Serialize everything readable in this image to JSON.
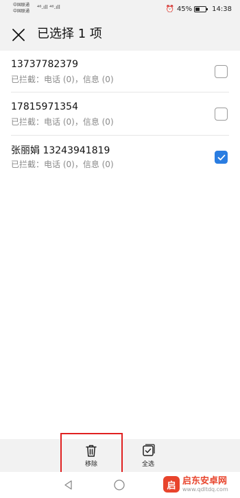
{
  "status_bar": {
    "carrier_1": "中国联通",
    "carrier_2": "中国联通",
    "signal": "⁴⁶.ıll ⁴⁶.ıll",
    "battery_percent": "45%",
    "battery_level": 0.45,
    "time": "14:38"
  },
  "header": {
    "close_icon": "close-icon",
    "title": "已选择 1 项"
  },
  "contacts": [
    {
      "number": "13737782379",
      "blocked": "已拦截：电话 (0)，信息 (0)",
      "checked": false
    },
    {
      "number": "17815971354",
      "blocked": "已拦截：电话 (0)，信息 (0)",
      "checked": false
    },
    {
      "number": "张丽娟 13243941819",
      "blocked": "已拦截：电话 (0)，信息 (0)",
      "checked": true
    }
  ],
  "bottom_actions": {
    "remove_label": "移除",
    "remove_icon": "trash-icon",
    "select_all_label": "全选",
    "select_all_icon": "select-all-icon"
  },
  "watermark": {
    "name": "启东安卓网",
    "url": "www.qdltdq.com"
  },
  "colors": {
    "accent": "#2a7de1",
    "highlight": "#e02020",
    "bar_background": "#f2f2f2"
  }
}
